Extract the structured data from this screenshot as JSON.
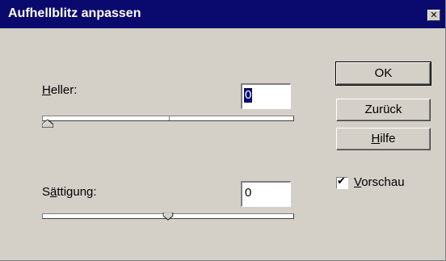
{
  "window": {
    "title": "Aufhellblitz anpassen",
    "close_glyph": "✕"
  },
  "heller": {
    "label_first": "H",
    "label_rest": "eller:",
    "value": "0",
    "slider_fraction": 0.0
  },
  "saettigung": {
    "label_pre": "S",
    "label_under": "ä",
    "label_rest": "ttigung:",
    "value": "0",
    "slider_fraction": 0.5
  },
  "buttons": {
    "ok": "OK",
    "zurueck": "Zurück",
    "hilfe_first": "H",
    "hilfe_rest": "ilfe"
  },
  "vorschau": {
    "checked": true,
    "label_first": "V",
    "label_rest": "orschau",
    "check_glyph": "✔"
  }
}
